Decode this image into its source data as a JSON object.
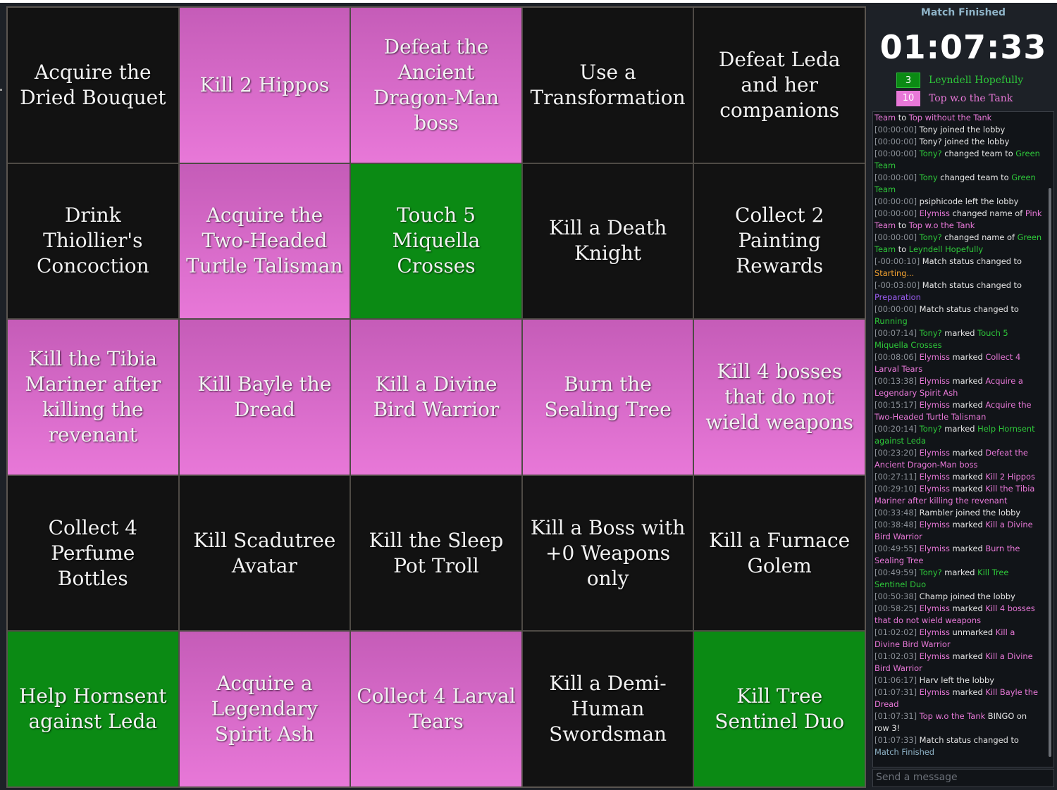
{
  "board": {
    "cells": [
      {
        "text": "Acquire the Dried Bouquet",
        "state": "none"
      },
      {
        "text": "Kill 2 Hippos",
        "state": "pink"
      },
      {
        "text": "Defeat the Ancient Dragon-Man boss",
        "state": "pink"
      },
      {
        "text": "Use a Transformation",
        "state": "none"
      },
      {
        "text": "Defeat Leda and her companions",
        "state": "none"
      },
      {
        "text": "Drink Thiollier's Concoction",
        "state": "none"
      },
      {
        "text": "Acquire the Two-Headed Turtle Talisman",
        "state": "pink"
      },
      {
        "text": "Touch 5 Miquella Crosses",
        "state": "green"
      },
      {
        "text": "Kill a Death Knight",
        "state": "none"
      },
      {
        "text": "Collect 2 Painting Rewards",
        "state": "none"
      },
      {
        "text": "Kill the Tibia Mariner after killing the revenant",
        "state": "pink"
      },
      {
        "text": "Kill Bayle the Dread",
        "state": "pink"
      },
      {
        "text": "Kill a Divine Bird Warrior",
        "state": "pink"
      },
      {
        "text": "Burn the Sealing Tree",
        "state": "pink"
      },
      {
        "text": "Kill 4 bosses that do not wield weapons",
        "state": "pink"
      },
      {
        "text": "Collect 4 Perfume Bottles",
        "state": "none"
      },
      {
        "text": "Kill Scadutree Avatar",
        "state": "none"
      },
      {
        "text": "Kill the Sleep Pot Troll",
        "state": "none"
      },
      {
        "text": "Kill a Boss with +0 Weapons only",
        "state": "none"
      },
      {
        "text": "Kill a Furnace Golem",
        "state": "none"
      },
      {
        "text": "Help Hornsent against Leda",
        "state": "green"
      },
      {
        "text": "Acquire a Legendary Spirit Ash",
        "state": "pink"
      },
      {
        "text": "Collect 4 Larval Tears",
        "state": "pink"
      },
      {
        "text": "Kill a Demi-Human Swordsman",
        "state": "none"
      },
      {
        "text": "Kill Tree Sentinel Duo",
        "state": "green"
      }
    ]
  },
  "sidebar": {
    "status": "Match Finished",
    "timer": "01:07:33",
    "teams": [
      {
        "score": "3",
        "name": "Leyndell Hopefully",
        "color": "#0b8a14"
      },
      {
        "score": "10",
        "name": "Top w.o the Tank",
        "color": "#e878d8"
      }
    ],
    "message_placeholder": "Send a message"
  },
  "colors": {
    "pink": "#e878d8",
    "green": "#0b8a14",
    "empty": "#121212",
    "timestamp": "#8a8f96"
  },
  "log": [
    [
      {
        "t": "Team",
        "c": "c-pink"
      },
      {
        "t": " to ",
        "c": "c-white"
      },
      {
        "t": "Top without the Tank",
        "c": "c-pink"
      }
    ],
    [
      {
        "t": "[00:00:00] ",
        "c": "ts"
      },
      {
        "t": "Tony joined the lobby",
        "c": "c-white"
      }
    ],
    [
      {
        "t": "[00:00:00] ",
        "c": "ts"
      },
      {
        "t": "Tony? joined the lobby",
        "c": "c-white"
      }
    ],
    [
      {
        "t": "[00:00:00] ",
        "c": "ts"
      },
      {
        "t": "Tony?",
        "c": "c-green"
      },
      {
        "t": " changed team to ",
        "c": "c-white"
      },
      {
        "t": "Green Team",
        "c": "c-green"
      }
    ],
    [
      {
        "t": "[00:00:00] ",
        "c": "ts"
      },
      {
        "t": "Tony",
        "c": "c-green"
      },
      {
        "t": " changed team to ",
        "c": "c-white"
      },
      {
        "t": "Green Team",
        "c": "c-green"
      }
    ],
    [
      {
        "t": "[00:00:00] ",
        "c": "ts"
      },
      {
        "t": "psiphicode left the lobby",
        "c": "c-white"
      }
    ],
    [
      {
        "t": "[00:00:00] ",
        "c": "ts"
      },
      {
        "t": "Elymiss",
        "c": "c-pink"
      },
      {
        "t": " changed name of ",
        "c": "c-white"
      },
      {
        "t": "Pink Team",
        "c": "c-pink"
      },
      {
        "t": " to ",
        "c": "c-white"
      },
      {
        "t": "Top w.o the Tank",
        "c": "c-pink"
      }
    ],
    [
      {
        "t": "[00:00:00] ",
        "c": "ts"
      },
      {
        "t": "Tony?",
        "c": "c-green"
      },
      {
        "t": " changed name of ",
        "c": "c-white"
      },
      {
        "t": "Green Team",
        "c": "c-green"
      },
      {
        "t": " to ",
        "c": "c-white"
      },
      {
        "t": "Leyndell Hopefully",
        "c": "c-green"
      }
    ],
    [
      {
        "t": "[-00:00:10] ",
        "c": "ts"
      },
      {
        "t": "Match status changed to ",
        "c": "c-white"
      },
      {
        "t": "Starting...",
        "c": "c-orange"
      }
    ],
    [
      {
        "t": "[-00:03:00] ",
        "c": "ts"
      },
      {
        "t": "Match status changed to ",
        "c": "c-white"
      },
      {
        "t": "Preparation",
        "c": "c-purple"
      }
    ],
    [
      {
        "t": "[00:00:00] ",
        "c": "ts"
      },
      {
        "t": "Match status changed to ",
        "c": "c-white"
      },
      {
        "t": "Running",
        "c": "c-green"
      }
    ],
    [
      {
        "t": "[00:07:14] ",
        "c": "ts"
      },
      {
        "t": "Tony?",
        "c": "c-green"
      },
      {
        "t": " marked ",
        "c": "c-white"
      },
      {
        "t": "Touch 5 Miquella Crosses",
        "c": "c-green"
      }
    ],
    [
      {
        "t": "[00:08:06] ",
        "c": "ts"
      },
      {
        "t": "Elymiss",
        "c": "c-pink"
      },
      {
        "t": " marked ",
        "c": "c-white"
      },
      {
        "t": "Collect 4 Larval Tears",
        "c": "c-pink"
      }
    ],
    [
      {
        "t": "[00:13:38] ",
        "c": "ts"
      },
      {
        "t": "Elymiss",
        "c": "c-pink"
      },
      {
        "t": " marked ",
        "c": "c-white"
      },
      {
        "t": "Acquire a Legendary Spirit Ash",
        "c": "c-pink"
      }
    ],
    [
      {
        "t": "[00:15:17] ",
        "c": "ts"
      },
      {
        "t": "Elymiss",
        "c": "c-pink"
      },
      {
        "t": " marked ",
        "c": "c-white"
      },
      {
        "t": "Acquire the Two-Headed Turtle Talisman",
        "c": "c-pink"
      }
    ],
    [
      {
        "t": "[00:20:14] ",
        "c": "ts"
      },
      {
        "t": "Tony?",
        "c": "c-green"
      },
      {
        "t": " marked ",
        "c": "c-white"
      },
      {
        "t": "Help Hornsent against Leda",
        "c": "c-green"
      }
    ],
    [
      {
        "t": "[00:23:20] ",
        "c": "ts"
      },
      {
        "t": "Elymiss",
        "c": "c-pink"
      },
      {
        "t": " marked ",
        "c": "c-white"
      },
      {
        "t": "Defeat the Ancient Dragon-Man boss",
        "c": "c-pink"
      }
    ],
    [
      {
        "t": "[00:27:11] ",
        "c": "ts"
      },
      {
        "t": "Elymiss",
        "c": "c-pink"
      },
      {
        "t": " marked ",
        "c": "c-white"
      },
      {
        "t": "Kill 2 Hippos",
        "c": "c-pink"
      }
    ],
    [
      {
        "t": "[00:29:10] ",
        "c": "ts"
      },
      {
        "t": "Elymiss",
        "c": "c-pink"
      },
      {
        "t": " marked ",
        "c": "c-white"
      },
      {
        "t": "Kill the Tibia Mariner after killing the revenant",
        "c": "c-pink"
      }
    ],
    [
      {
        "t": "[00:33:48] ",
        "c": "ts"
      },
      {
        "t": "Rambler joined the lobby",
        "c": "c-white"
      }
    ],
    [
      {
        "t": "[00:38:48] ",
        "c": "ts"
      },
      {
        "t": "Elymiss",
        "c": "c-pink"
      },
      {
        "t": " marked ",
        "c": "c-white"
      },
      {
        "t": "Kill a Divine Bird Warrior",
        "c": "c-pink"
      }
    ],
    [
      {
        "t": "[00:49:55] ",
        "c": "ts"
      },
      {
        "t": "Elymiss",
        "c": "c-pink"
      },
      {
        "t": " marked ",
        "c": "c-white"
      },
      {
        "t": "Burn the Sealing Tree",
        "c": "c-pink"
      }
    ],
    [
      {
        "t": "[00:49:59] ",
        "c": "ts"
      },
      {
        "t": "Tony?",
        "c": "c-green"
      },
      {
        "t": " marked ",
        "c": "c-white"
      },
      {
        "t": "Kill Tree Sentinel Duo",
        "c": "c-green"
      }
    ],
    [
      {
        "t": "[00:50:38] ",
        "c": "ts"
      },
      {
        "t": "Champ joined the lobby",
        "c": "c-white"
      }
    ],
    [
      {
        "t": "[00:58:25] ",
        "c": "ts"
      },
      {
        "t": "Elymiss",
        "c": "c-pink"
      },
      {
        "t": " marked ",
        "c": "c-white"
      },
      {
        "t": "Kill 4 bosses that do not wield weapons",
        "c": "c-pink"
      }
    ],
    [
      {
        "t": "[01:02:02] ",
        "c": "ts"
      },
      {
        "t": "Elymiss",
        "c": "c-pink"
      },
      {
        "t": " unmarked ",
        "c": "c-white"
      },
      {
        "t": "Kill a Divine Bird Warrior",
        "c": "c-pink"
      }
    ],
    [
      {
        "t": "[01:02:03] ",
        "c": "ts"
      },
      {
        "t": "Elymiss",
        "c": "c-pink"
      },
      {
        "t": " marked ",
        "c": "c-white"
      },
      {
        "t": "Kill a Divine Bird Warrior",
        "c": "c-pink"
      }
    ],
    [
      {
        "t": "[01:06:17] ",
        "c": "ts"
      },
      {
        "t": "Harv left the lobby",
        "c": "c-white"
      }
    ],
    [
      {
        "t": "[01:07:31] ",
        "c": "ts"
      },
      {
        "t": "Elymiss",
        "c": "c-pink"
      },
      {
        "t": " marked ",
        "c": "c-white"
      },
      {
        "t": "Kill Bayle the Dread",
        "c": "c-pink"
      }
    ],
    [
      {
        "t": "[01:07:31] ",
        "c": "ts"
      },
      {
        "t": "Top w.o the Tank",
        "c": "c-pink"
      },
      {
        "t": " BINGO on row 3!",
        "c": "c-white"
      }
    ],
    [
      {
        "t": "[01:07:33] ",
        "c": "ts"
      },
      {
        "t": "Match status changed to ",
        "c": "c-white"
      },
      {
        "t": "Match Finished",
        "c": "c-blue"
      }
    ]
  ]
}
